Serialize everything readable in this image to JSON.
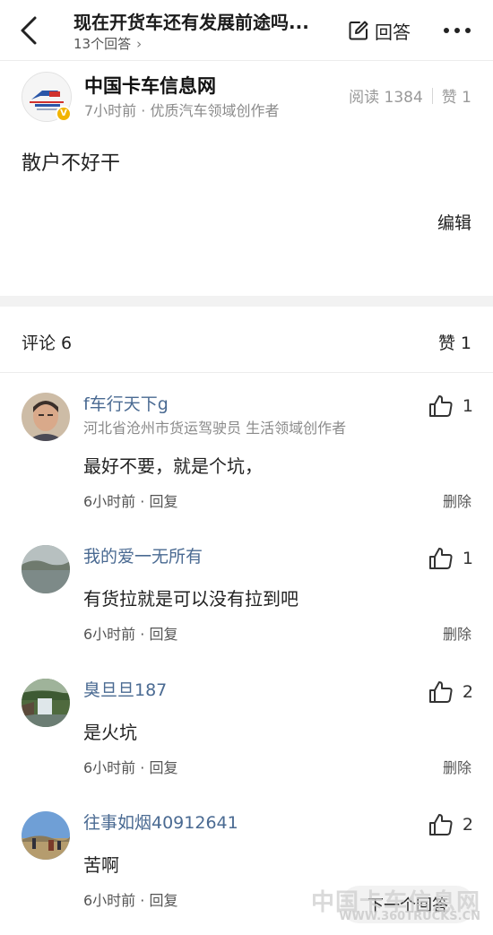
{
  "header": {
    "title": "现在开货车还有发展前途吗...",
    "answers_count": "13个回答",
    "answer_button": "回答"
  },
  "author": {
    "name": "中国卡车信息网",
    "meta": "7小时前 · 优质汽车领域创作者",
    "read": "阅读 1384",
    "likes": "赞 1",
    "content": "散户不好干",
    "edit": "编辑",
    "badge": "V"
  },
  "comments_header": {
    "count": "评论 6",
    "likes": "赞 1"
  },
  "comments": [
    {
      "name": "f车行天下g",
      "subtitle": "河北省沧州市货运驾驶员 生活领域创作者",
      "text": "最好不要，就是个坑，",
      "time": "6小时前 · 回复",
      "delete": "删除",
      "likes": "1"
    },
    {
      "name": "我的爱一无所有",
      "text": "有货拉就是可以没有拉到吧",
      "time": "6小时前 · 回复",
      "delete": "删除",
      "likes": "1"
    },
    {
      "name": "臭旦旦187",
      "text": "是火坑",
      "time": "6小时前 · 回复",
      "delete": "删除",
      "likes": "2"
    },
    {
      "name": "往事如烟40912641",
      "text": "苦啊",
      "time": "6小时前 · 回复",
      "likes": "2"
    }
  ],
  "bottom": {
    "next_answer": "下一个回答"
  },
  "watermark": {
    "text": "中国卡车信息网",
    "url": "WWW.360TRUCKS.CN"
  },
  "icons": {
    "back": "chevron-left-icon",
    "edit": "pencil-square-icon",
    "more": "more-horizontal-icon",
    "like": "thumbs-up-icon"
  }
}
